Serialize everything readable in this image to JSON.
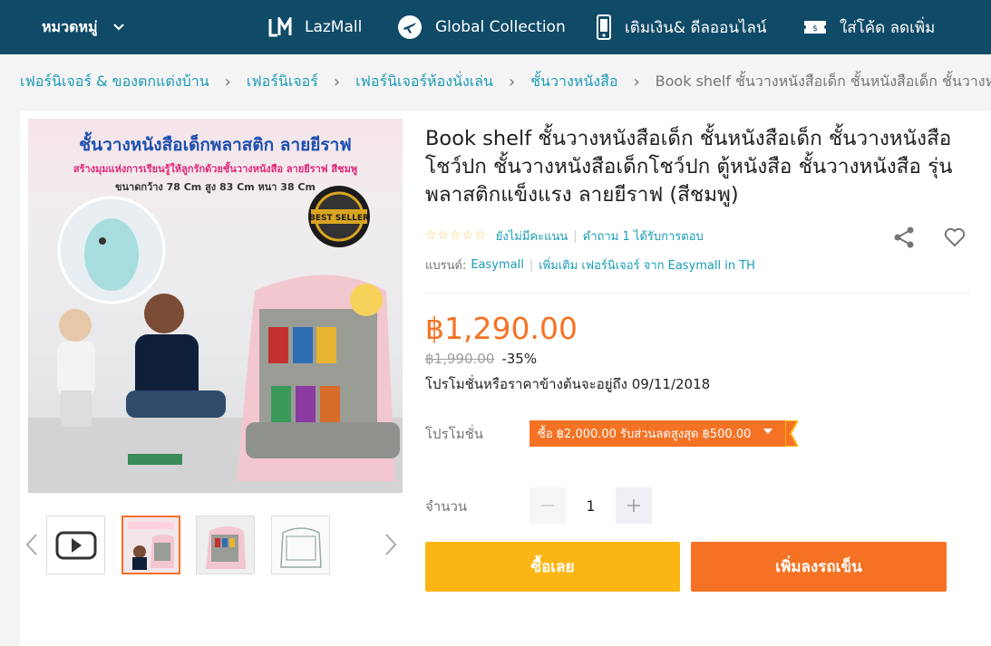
{
  "topnav": {
    "category_label": "หมวดหมู่",
    "items": [
      {
        "label": "LazMall",
        "icon": "lazmall-icon"
      },
      {
        "label": "Global Collection",
        "icon": "airplane-globe-icon"
      },
      {
        "label": "เติมเงิน& ดีลออนไลน์",
        "icon": "mobile-phone-icon"
      },
      {
        "label": "ใส่โค้ด ลดเพิ่ม",
        "icon": "voucher-ticket-icon"
      }
    ],
    "bg_color": "#0f4a67"
  },
  "breadcrumb": {
    "items": [
      "เฟอร์นิเจอร์ & ของตกแต่งบ้าน",
      "เฟอร์นิเจอร์",
      "เฟอร์นิเจอร์ห้องนั่งเล่น",
      "ชั้นวางหนังสือ"
    ],
    "current": "Book shelf ชั้นวางหนังสือเด็ก ชั้นหนังสือเด็ก ชั้นวางหนังสือ"
  },
  "gallery": {
    "main_image": {
      "headline": "ชั้นวางหนังสือเด็กพลาสติก ลายยีราฟ",
      "subline": "สร้างมุมแห่งการเรียนรู้ให้ลูกรักด้วยชั้นวางหนังสือ ลายยีราฟ สีชมพู",
      "size_line": "ขนาดกว้าง 78 Cm สูง 83 Cm หนา 38 Cm",
      "badge_text": "BEST SELLER"
    },
    "thumbnails": [
      "video",
      "image-1",
      "image-2",
      "image-3"
    ],
    "active_thumbnail": 1
  },
  "product": {
    "title": "Book shelf ชั้นวางหนังสือเด็ก ชั้นหนังสือเด็ก ชั้นวางหนังสือโชว์ปก ชั้นวางหนังสือเด็กโชว์ปก ตู้หนังสือ ชั้นวางหนังสือ รุ่นพลาสติกแข็งแรง ลายยีราฟ (สีชมพู)",
    "stars": "☆☆☆☆☆",
    "rating_text": "ยังไม่มีคะแนน",
    "qa_text": "คำถาม 1 ได้รับการตอบ",
    "brand_label": "แบรนด์:",
    "brand": "Easymall",
    "more_link": "เพิ่มเติม เฟอร์นิเจอร์ จาก Easymall in TH",
    "price": "฿1,290.00",
    "original_price": "฿1,990.00",
    "discount": "-35%",
    "promo_until": "โปรโมชั่นหรือราคาข้างต้นจะอยู่ถึง 09/11/2018",
    "promo_label": "โปรโมชั่น",
    "promo_tag": "ซื้อ ฿2,000.00 รับส่วนลดสูงสุด ฿500.00",
    "quantity_label": "จำนวน",
    "quantity": "1",
    "buy_now_label": "ซื้อเลย",
    "add_to_cart_label": "เพิ่มลงรถเข็น",
    "accent_color": "#f57224",
    "buy_color": "#fcb614",
    "link_color": "#1a9cb7"
  }
}
